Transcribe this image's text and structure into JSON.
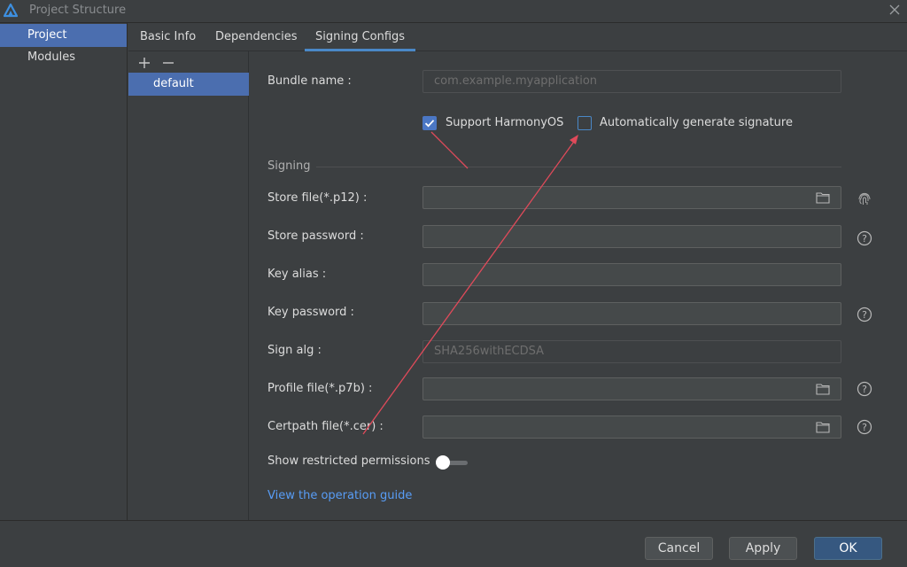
{
  "window": {
    "title": "Project Structure"
  },
  "nav": {
    "items": [
      {
        "label": "Project",
        "selected": true
      },
      {
        "label": "Modules",
        "selected": false
      }
    ]
  },
  "tabs": [
    {
      "label": "Basic Info"
    },
    {
      "label": "Dependencies"
    },
    {
      "label": "Signing Configs",
      "active": true
    }
  ],
  "configs": {
    "add_icon": "plus-icon",
    "remove_icon": "minus-icon",
    "items": [
      {
        "label": "default"
      }
    ]
  },
  "form": {
    "bundle_name": {
      "label": "Bundle name :",
      "value": "com.example.myapplication"
    },
    "support_harmonyos": {
      "label": "Support HarmonyOS",
      "checked": true
    },
    "auto_generate": {
      "label": "Automatically generate signature",
      "checked": false
    },
    "signing_section": "Signing",
    "store_file": {
      "label": "Store file(*.p12) :",
      "value": ""
    },
    "store_password": {
      "label": "Store password :",
      "value": ""
    },
    "key_alias": {
      "label": "Key alias :",
      "value": ""
    },
    "key_password": {
      "label": "Key password :",
      "value": ""
    },
    "sign_alg": {
      "label": "Sign alg :",
      "value": "SHA256withECDSA"
    },
    "profile_file": {
      "label": "Profile file(*.p7b) :",
      "value": ""
    },
    "certpath_file": {
      "label": "Certpath file(*.cer) :",
      "value": ""
    },
    "show_restricted": {
      "label": "Show restricted permissions",
      "on": false
    },
    "guide_link": "View the operation guide"
  },
  "buttons": {
    "cancel": "Cancel",
    "apply": "Apply",
    "ok": "OK"
  },
  "colors": {
    "accent": "#4b6eaf",
    "link": "#589df6",
    "annotation": "#e04a5a"
  }
}
